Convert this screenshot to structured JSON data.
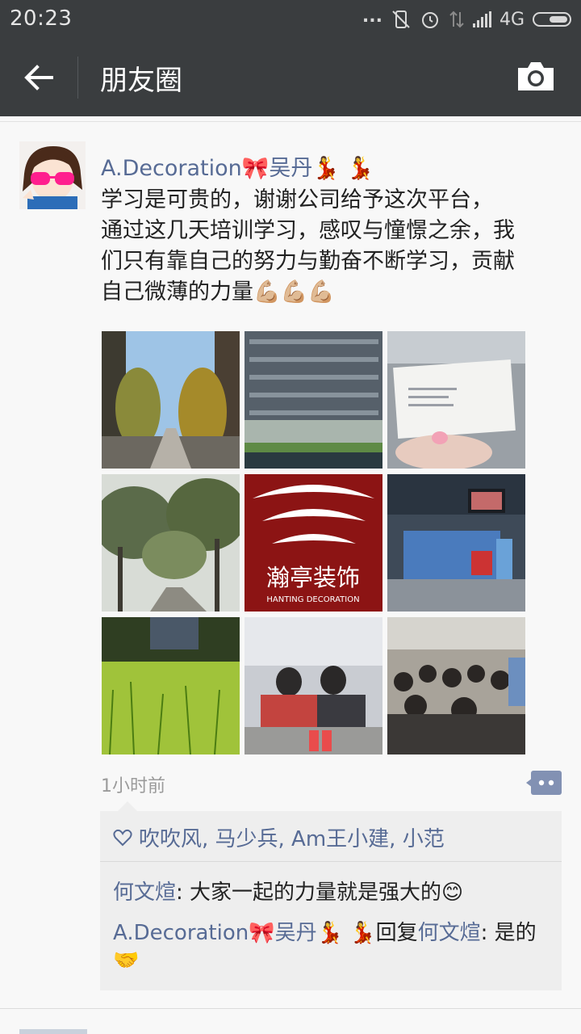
{
  "status": {
    "time": "20:23",
    "dots": "...",
    "network": "4G"
  },
  "nav": {
    "title": "朋友圈"
  },
  "post": {
    "author": "A.Decoration🎀吴丹💃 💃",
    "content_lines": [
      "  学习是可贵的，谢谢公司给予这次平台，",
      "通过这几天培训学习，感叹与憧憬之余，我",
      "们只有靠自己的努力与勤奋不断学习，贡献",
      "自己微薄的力量💪🏼💪🏼💪🏼"
    ],
    "logo_text_main": "瀚亭装饰",
    "logo_text_sub": "HANTING DECORATION",
    "time": "1小时前",
    "likes": "吹吹风, 马少兵, Am王小建, 小范",
    "comments": [
      {
        "author": "何文煊",
        "text": ": 大家一起的力量就是强大的😊"
      },
      {
        "author": "A.Decoration🎀吴丹💃 💃",
        "reply_word": "回复",
        "reply_to": "何文煊",
        "text": ": 是的🤝"
      }
    ]
  },
  "colors": {
    "bar": "#3a3d3f",
    "name": "#576b95",
    "bg": "#f8f8f8"
  }
}
